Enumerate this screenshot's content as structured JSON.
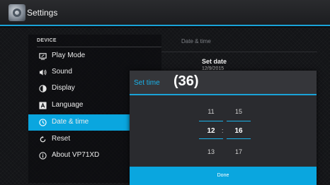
{
  "app": {
    "title": "Settings",
    "icon": "settings-gear-icon"
  },
  "settings": {
    "section": "DEVICE",
    "items": [
      {
        "label": "Play Mode",
        "icon": "monitor-icon"
      },
      {
        "label": "Sound",
        "icon": "speaker-icon"
      },
      {
        "label": "Display",
        "icon": "brightness-icon"
      },
      {
        "label": "Language",
        "icon": "language-icon"
      },
      {
        "label": "Date & time",
        "icon": "clock-icon",
        "selected": true
      },
      {
        "label": "Reset",
        "icon": "reset-icon"
      },
      {
        "label": "About VP71XD",
        "icon": "info-icon"
      }
    ]
  },
  "detail": {
    "header": "Date & time",
    "set_date_label": "Set date",
    "set_date_value": "12/9/2015"
  },
  "dialog": {
    "title": "Set time",
    "badge": "(36)",
    "hours": {
      "prev": "11",
      "current": "12",
      "next": "13"
    },
    "minutes": {
      "prev": "15",
      "current": "16",
      "next": "17"
    },
    "separator": ":",
    "done_label": "Done"
  },
  "colors": {
    "accent": "#1aa3d8",
    "selected_bg": "#0aa6df",
    "background": "#131417"
  }
}
